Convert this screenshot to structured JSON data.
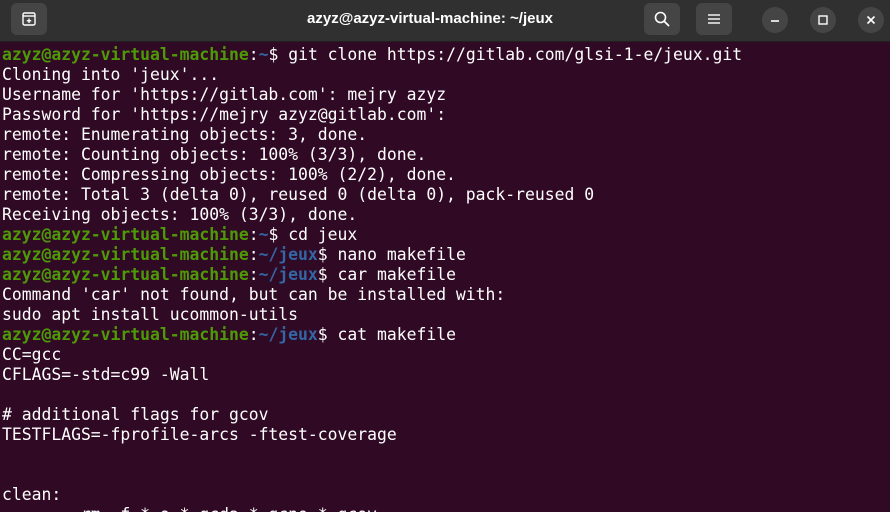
{
  "window": {
    "title": "azyz@azyz-virtual-machine: ~/jeux"
  },
  "titlebar_icons": {
    "new_tab": "new-tab-icon",
    "search": "search-icon",
    "menu": "hamburger-menu-icon",
    "minimize": "minimize-icon",
    "maximize": "maximize-icon",
    "close": "close-icon"
  },
  "colors": {
    "background": "#300a24",
    "prompt_user": "#4e9a06",
    "prompt_path": "#3465a4",
    "text": "#ffffff"
  },
  "terminal": {
    "prompt_user": "azyz@azyz-virtual-machine",
    "lines": [
      {
        "type": "prompt",
        "path": "~",
        "cmd": "git clone https://gitlab.com/glsi-1-e/jeux.git"
      },
      {
        "type": "output",
        "text": "Cloning into 'jeux'..."
      },
      {
        "type": "output",
        "text": "Username for 'https://gitlab.com': mejry azyz"
      },
      {
        "type": "output",
        "text": "Password for 'https://mejry azyz@gitlab.com':"
      },
      {
        "type": "output",
        "text": "remote: Enumerating objects: 3, done."
      },
      {
        "type": "output",
        "text": "remote: Counting objects: 100% (3/3), done."
      },
      {
        "type": "output",
        "text": "remote: Compressing objects: 100% (2/2), done."
      },
      {
        "type": "output",
        "text": "remote: Total 3 (delta 0), reused 0 (delta 0), pack-reused 0"
      },
      {
        "type": "output",
        "text": "Receiving objects: 100% (3/3), done."
      },
      {
        "type": "prompt",
        "path": "~",
        "cmd": "cd jeux"
      },
      {
        "type": "prompt",
        "path": "~/jeux",
        "cmd": "nano makefile"
      },
      {
        "type": "prompt",
        "path": "~/jeux",
        "cmd": "car makefile"
      },
      {
        "type": "output",
        "text": "Command 'car' not found, but can be installed with:"
      },
      {
        "type": "output",
        "text": "sudo apt install ucommon-utils"
      },
      {
        "type": "prompt",
        "path": "~/jeux",
        "cmd": "cat makefile"
      },
      {
        "type": "output",
        "text": "CC=gcc"
      },
      {
        "type": "output",
        "text": "CFLAGS=-std=c99 -Wall"
      },
      {
        "type": "output",
        "text": ""
      },
      {
        "type": "output",
        "text": "# additional flags for gcov"
      },
      {
        "type": "output",
        "text": "TESTFLAGS=-fprofile-arcs -ftest-coverage"
      },
      {
        "type": "output",
        "text": ""
      },
      {
        "type": "output",
        "text": ""
      },
      {
        "type": "output",
        "text": "clean:"
      },
      {
        "type": "output",
        "text": "        rm -f *.o *.gcda *.gcno *.gcov"
      }
    ]
  }
}
